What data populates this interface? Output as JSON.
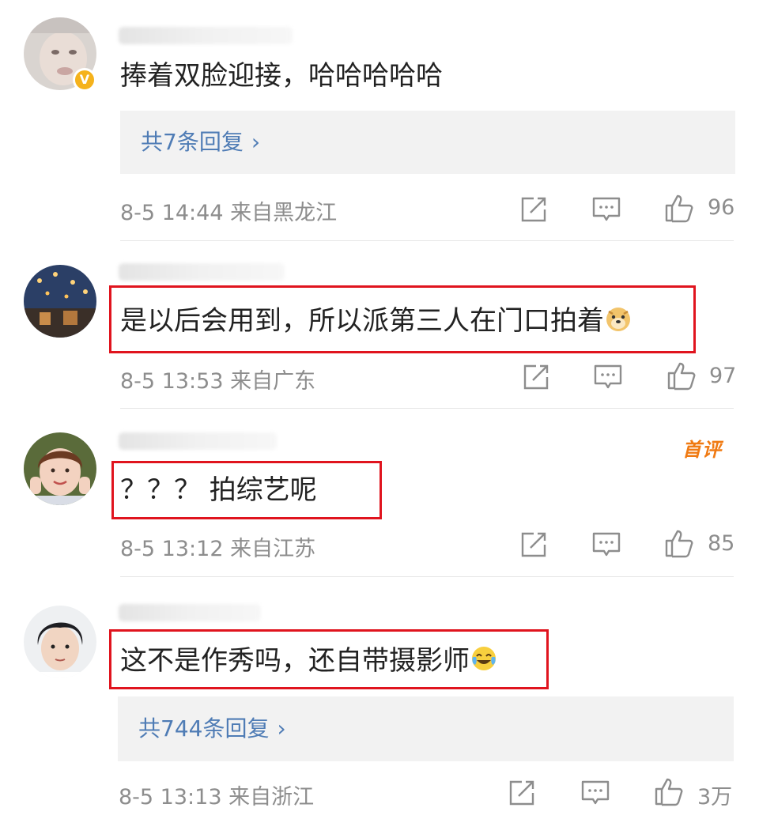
{
  "comments": [
    {
      "text": "捧着双脸迎接，哈哈哈哈哈",
      "replies": "共7条回复",
      "time": "8-5 14:44",
      "location": "来自黑龙江",
      "likes": "96",
      "verified": true,
      "highlighted": false
    },
    {
      "text": "是以后会用到，所以派第三人在门口拍着",
      "emoji": "doge-emoji",
      "time": "8-5 13:53",
      "location": "来自广东",
      "likes": "97",
      "highlighted": true
    },
    {
      "text": "？？？ 拍综艺呢",
      "badge": "首评",
      "time": "8-5 13:12",
      "location": "来自江苏",
      "likes": "85",
      "highlighted": true
    },
    {
      "text": "这不是作秀吗，还自带摄影师",
      "emoji": "laugh-cry-emoji",
      "replies": "共744条回复",
      "time": "8-5 13:13",
      "location": "来自浙江",
      "likes": "3万",
      "highlighted": true
    }
  ],
  "icons": {
    "share": "share-icon",
    "comment": "comment-icon",
    "like": "thumbs-up-icon",
    "reply_chevron": "chevron-right-icon"
  },
  "colors": {
    "highlight_box": "#e0141e",
    "reply_link": "#4f7cb5",
    "meta_text": "#8d8d8d",
    "first_badge": "#f07a12",
    "verified_badge": "#f5b21c"
  }
}
